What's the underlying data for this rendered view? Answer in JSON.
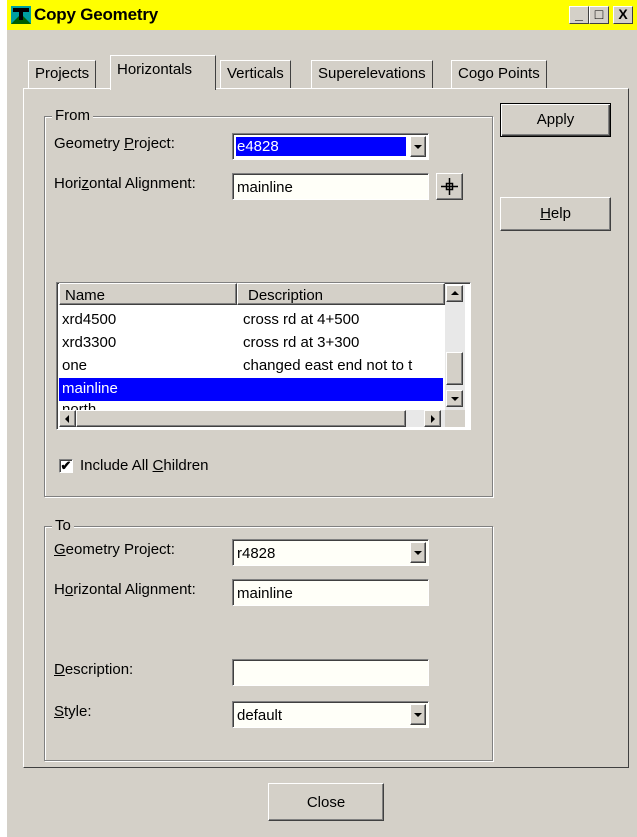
{
  "window": {
    "title": "Copy Geometry",
    "minimize": "_",
    "maximize": "□",
    "close": "X"
  },
  "tabs": [
    {
      "label": "Projects"
    },
    {
      "label": "Horizontals"
    },
    {
      "label": "Verticals"
    },
    {
      "label": "Superelevations"
    },
    {
      "label": "Cogo Points"
    }
  ],
  "active_tab": "Horizontals",
  "from": {
    "group_label": "From",
    "geometry_project_label": "Geometry Project:",
    "geometry_project_value": "e4828",
    "horizontal_alignment_label": "Horizontal Alignment:",
    "horizontal_alignment_value": "mainline",
    "list": {
      "columns": [
        "Name",
        "Description"
      ],
      "rows": [
        {
          "name": "xrd4500",
          "description": "cross rd at 4+500"
        },
        {
          "name": "xrd3300",
          "description": "cross rd at 3+300"
        },
        {
          "name": "one",
          "description": "changed east end not to t"
        },
        {
          "name": "mainline",
          "description": ""
        },
        {
          "name": "north",
          "description": ""
        }
      ],
      "selected_row": 3
    },
    "include_children_label": "Include All Children",
    "include_children_checked": true
  },
  "to": {
    "group_label": "To",
    "geometry_project_label": "Geometry Project:",
    "geometry_project_value": "r4828",
    "horizontal_alignment_label": "Horizontal Alignment:",
    "horizontal_alignment_value": "mainline",
    "description_label": "Description:",
    "description_value": "",
    "style_label": "Style:",
    "style_value": "default"
  },
  "buttons": {
    "apply": "Apply",
    "help": "Help",
    "close": "Close"
  },
  "colors": {
    "title_bar": "#ffff00",
    "selection": "#0000ff",
    "face": "#d4d0c8"
  }
}
